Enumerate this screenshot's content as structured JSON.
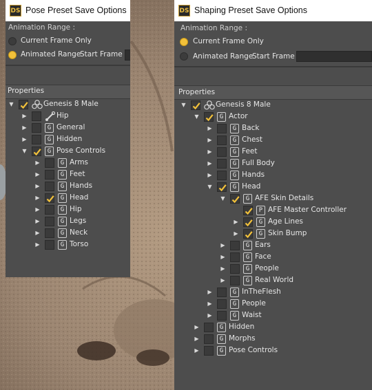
{
  "dialog_pose": {
    "icon": "DS",
    "title": "Pose Preset Save Options",
    "animation_range_label": "Animation Range :",
    "option_current": "Current Frame Only",
    "option_animated": "Animated Range",
    "start_frame_label": "Start Frame",
    "properties_label": "Properties",
    "tree": [
      {
        "label": "Genesis 8 Male",
        "level": 0,
        "expand": "open",
        "checked": true,
        "icon": "figure-icon"
      },
      {
        "label": "Hip",
        "level": 1,
        "expand": "closed",
        "checked": false,
        "icon": "bone-icon"
      },
      {
        "label": "General",
        "level": 1,
        "expand": "closed",
        "checked": false,
        "icon": "group-icon"
      },
      {
        "label": "Hidden",
        "level": 1,
        "expand": "closed",
        "checked": false,
        "icon": "group-icon"
      },
      {
        "label": "Pose Controls",
        "level": 1,
        "expand": "open",
        "checked": true,
        "icon": "group-icon"
      },
      {
        "label": "Arms",
        "level": 2,
        "expand": "closed",
        "checked": false,
        "icon": "group-icon"
      },
      {
        "label": "Feet",
        "level": 2,
        "expand": "closed",
        "checked": false,
        "icon": "group-icon"
      },
      {
        "label": "Hands",
        "level": 2,
        "expand": "closed",
        "checked": false,
        "icon": "group-icon"
      },
      {
        "label": "Head",
        "level": 2,
        "expand": "closed",
        "checked": true,
        "icon": "group-icon"
      },
      {
        "label": "Hip",
        "level": 2,
        "expand": "closed",
        "checked": false,
        "icon": "group-icon"
      },
      {
        "label": "Legs",
        "level": 2,
        "expand": "closed",
        "checked": false,
        "icon": "group-icon"
      },
      {
        "label": "Neck",
        "level": 2,
        "expand": "closed",
        "checked": false,
        "icon": "group-icon"
      },
      {
        "label": "Torso",
        "level": 2,
        "expand": "closed",
        "checked": false,
        "icon": "group-icon"
      }
    ]
  },
  "dialog_shaping": {
    "icon": "DS",
    "title": "Shaping Preset Save Options",
    "animation_range_label": "Animation Range :",
    "option_current": "Current Frame Only",
    "option_animated": "Animated Range",
    "start_frame_label": "Start Frame :",
    "properties_label": "Properties",
    "tree": [
      {
        "label": "Genesis 8 Male",
        "level": 0,
        "expand": "open",
        "checked": true,
        "icon": "figure-icon"
      },
      {
        "label": "Actor",
        "level": 1,
        "expand": "open",
        "checked": true,
        "icon": "group-icon"
      },
      {
        "label": "Back",
        "level": 2,
        "expand": "closed",
        "checked": false,
        "icon": "group-icon"
      },
      {
        "label": "Chest",
        "level": 2,
        "expand": "closed",
        "checked": false,
        "icon": "group-icon"
      },
      {
        "label": "Feet",
        "level": 2,
        "expand": "closed",
        "checked": false,
        "icon": "group-icon"
      },
      {
        "label": "Full Body",
        "level": 2,
        "expand": "closed",
        "checked": false,
        "icon": "group-icon"
      },
      {
        "label": "Hands",
        "level": 2,
        "expand": "closed",
        "checked": false,
        "icon": "group-icon"
      },
      {
        "label": "Head",
        "level": 2,
        "expand": "open",
        "checked": true,
        "icon": "group-icon"
      },
      {
        "label": "AFE Skin Details",
        "level": 3,
        "expand": "open",
        "checked": true,
        "icon": "group-icon"
      },
      {
        "label": "AFE Master Controller",
        "level": 4,
        "expand": "none",
        "checked": true,
        "icon": "property-icon"
      },
      {
        "label": "Age Lines",
        "level": 4,
        "expand": "closed",
        "checked": true,
        "icon": "group-icon"
      },
      {
        "label": "Skin Bump",
        "level": 4,
        "expand": "closed",
        "checked": true,
        "icon": "group-icon"
      },
      {
        "label": "Ears",
        "level": 3,
        "expand": "closed",
        "checked": false,
        "icon": "group-icon"
      },
      {
        "label": "Face",
        "level": 3,
        "expand": "closed",
        "checked": false,
        "icon": "group-icon"
      },
      {
        "label": "People",
        "level": 3,
        "expand": "closed",
        "checked": false,
        "icon": "group-icon"
      },
      {
        "label": "Real World",
        "level": 3,
        "expand": "closed",
        "checked": false,
        "icon": "group-icon"
      },
      {
        "label": "InTheFlesh",
        "level": 2,
        "expand": "closed",
        "checked": false,
        "icon": "group-icon"
      },
      {
        "label": "People",
        "level": 2,
        "expand": "closed",
        "checked": false,
        "icon": "group-icon"
      },
      {
        "label": "Waist",
        "level": 2,
        "expand": "closed",
        "checked": false,
        "icon": "group-icon"
      },
      {
        "label": "Hidden",
        "level": 1,
        "expand": "closed",
        "checked": false,
        "icon": "group-icon"
      },
      {
        "label": "Morphs",
        "level": 1,
        "expand": "closed",
        "checked": false,
        "icon": "group-icon"
      },
      {
        "label": "Pose Controls",
        "level": 1,
        "expand": "closed",
        "checked": false,
        "icon": "group-icon"
      }
    ]
  }
}
